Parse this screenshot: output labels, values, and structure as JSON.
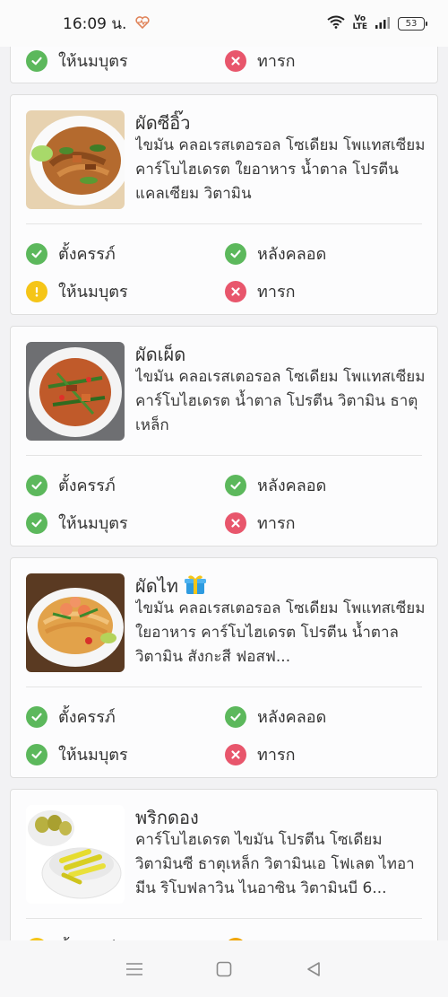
{
  "status_bar": {
    "time": "16:09 น.",
    "battery": "53"
  },
  "labels": {
    "pregnant": "ตั้งครรภ์",
    "postpartum": "หลังคลอด",
    "breastfeeding": "ให้นมบุตร",
    "infant": "ทารก"
  },
  "top_partial": {
    "breastfeeding_status": "ok",
    "infant_status": "no"
  },
  "foods": [
    {
      "name": "ผัดซีอิ๊ว",
      "nutrients": "ไขมัน คลอเรสเตอรอล โซเดียม โพแทสเซียม คาร์โบไฮเดรต ใยอาหาร น้ำตาล โปรตีน แคลเซียม วิตามิน",
      "status": {
        "pregnant": "ok",
        "postpartum": "ok",
        "breastfeeding": "warn",
        "infant": "no"
      }
    },
    {
      "name": "ผัดเผ็ด",
      "nutrients": "ไขมัน คลอเรสเตอรอล โซเดียม โพแทสเซียม คาร์โบไฮเดรต น้ำตาล โปรตีน วิตามิน ธาตุเหล็ก",
      "status": {
        "pregnant": "ok",
        "postpartum": "ok",
        "breastfeeding": "ok",
        "infant": "no"
      }
    },
    {
      "name": "ผัดไท",
      "gift_icon": "gift-icon",
      "nutrients": "ไขมัน คลอเรสเตอรอล โซเดียม โพแทสเซียม ใยอาหาร คาร์โบไฮเดรต โปรตีน น้ำตาล วิตามิน สังกะสี ฟอสฟ...",
      "status": {
        "pregnant": "ok",
        "postpartum": "ok",
        "breastfeeding": "ok",
        "infant": "no"
      }
    },
    {
      "name": "พริกดอง",
      "nutrients": "คาร์โบไฮเดรต ไขมัน โปรตีน โซเดียม วิตามินซี ธาตุเหล็ก วิตามินเอ โฟเลต ไทอามีน ริโบฟลาวิน ไนอาซิน วิตามินบี 6...",
      "status": {
        "pregnant": "warn",
        "postpartum": "warn-orange"
      }
    }
  ],
  "colors": {
    "ok": "#5cb85c",
    "warn": "#f5c518",
    "no": "#e8566c",
    "orange": "#f0a500"
  },
  "nav_icons": [
    "menu-icon",
    "home-square-icon",
    "back-triangle-icon"
  ]
}
